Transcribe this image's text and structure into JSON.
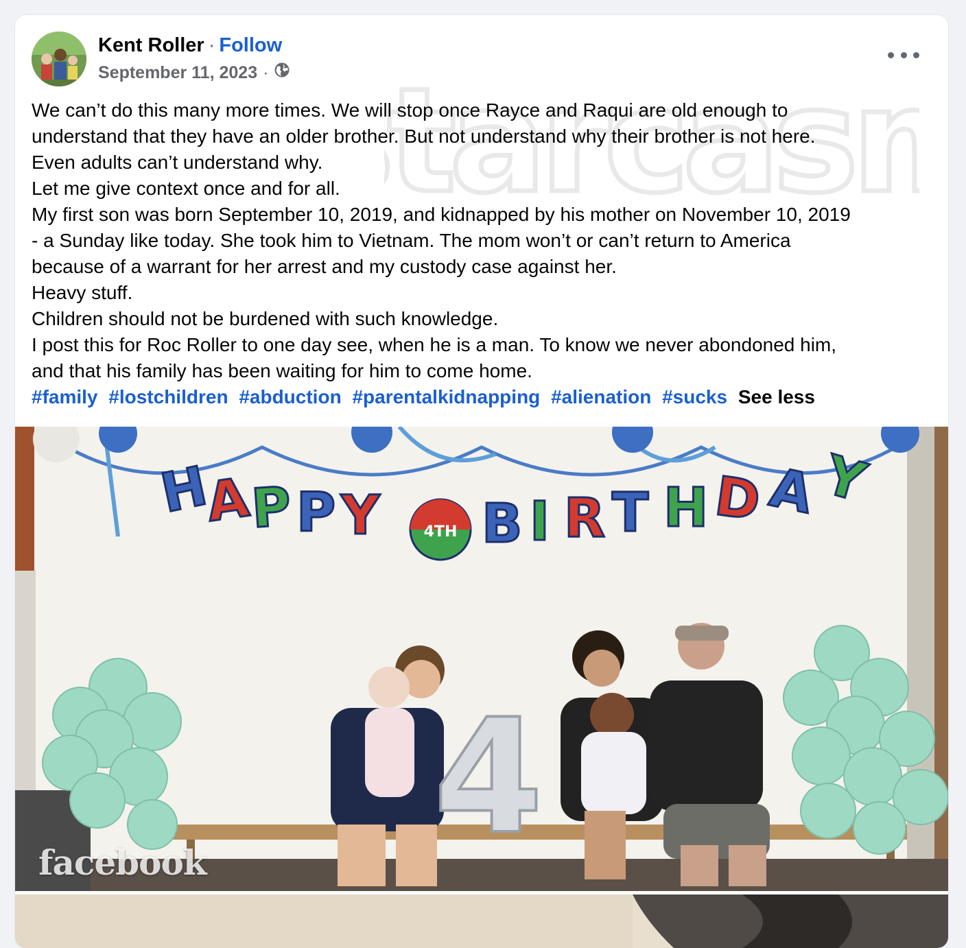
{
  "post": {
    "author": "Kent Roller",
    "separator": "·",
    "follow_label": "Follow",
    "date": "September 11, 2023",
    "meta_separator": "·",
    "privacy_icon": "globe-icon",
    "more_icon": "more-options-icon",
    "watermark_text": "starcasm",
    "body_lines": [
      "We can’t do this many more times. We will stop once  Rayce and Raqui are old enough to",
      "understand that they have an older brother. But not understand why their brother is not here.",
      "Even adults can’t understand why.",
      "Let me give context once and for all.",
      "My first son was born September 10, 2019, and kidnapped by his mother on November 10, 2019",
      "- a Sunday like today.  She took him to Vietnam.  The mom won’t or can’t return to America",
      "because of a warrant for her arrest and my custody case against her.",
      "Heavy stuff.",
      "Children should not be burdened with such knowledge.",
      "I post this for Roc Roller to one day see, when he is a man.  To know we never abondoned him,",
      "and that his family has been waiting for him to come home."
    ],
    "hashtags": [
      "#family",
      "#lostchildren",
      "#abduction",
      "#parentalkidnapping",
      "#alienation",
      "#sucks"
    ],
    "see_less_label": "See less",
    "photo": {
      "banner_letters": [
        "H",
        "A",
        "P",
        "P",
        "Y",
        "",
        "B",
        "I",
        "R",
        "T",
        "H",
        "D",
        "A",
        "Y"
      ],
      "age_badge": "4TH",
      "balloon_number": "4",
      "watermark": "facebook"
    }
  },
  "colors": {
    "link": "#1a5fcf",
    "text": "#050505",
    "secondary": "#65676b",
    "balloon": "#9ed9c4"
  }
}
